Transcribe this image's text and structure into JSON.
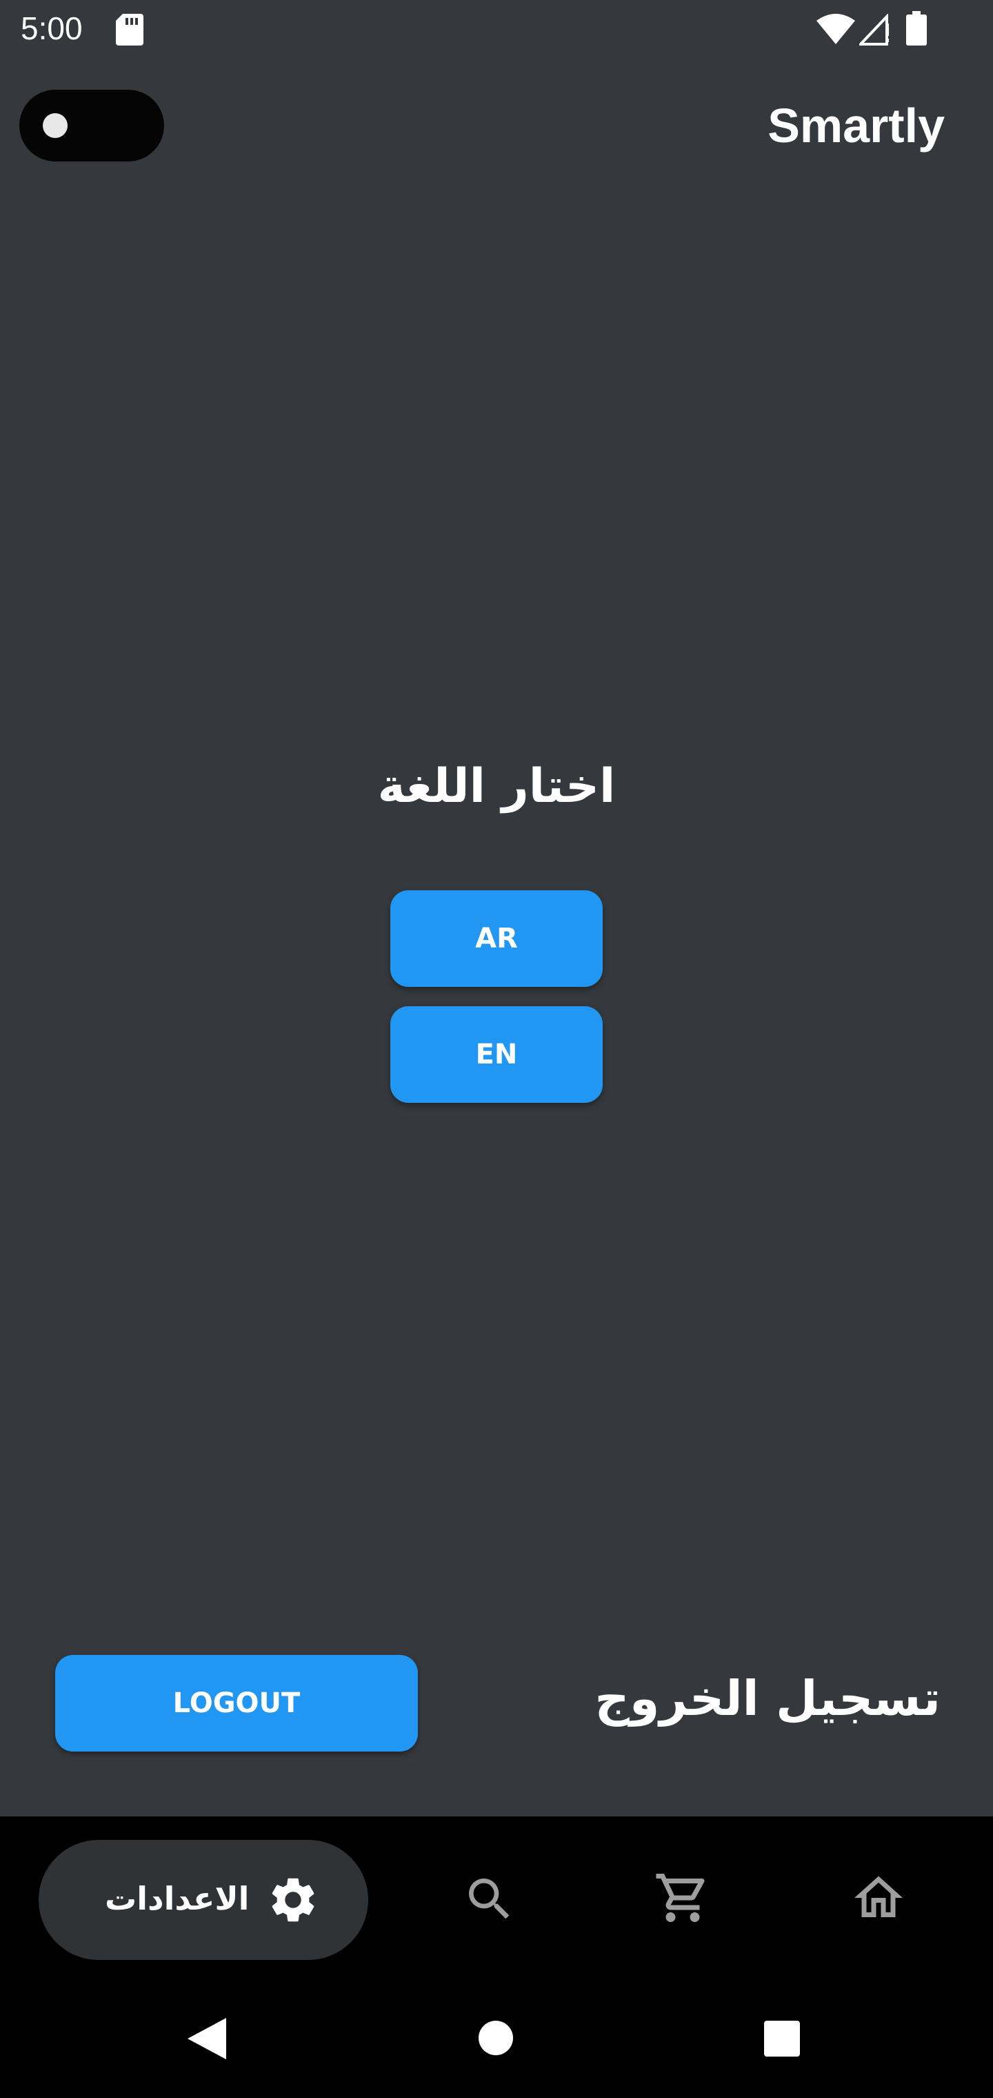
{
  "status_bar": {
    "time": "5:00"
  },
  "header": {
    "title": "Smartly"
  },
  "language": {
    "heading": "اختار اللغة",
    "ar_label": "AR",
    "en_label": "EN"
  },
  "logout": {
    "button_label": "LOGOUT",
    "label": "تسجيل الخروج"
  },
  "bottom_nav": {
    "settings_label": "الاعدادات",
    "icons": [
      "gear-icon",
      "search-icon",
      "cart-icon",
      "home-icon"
    ]
  },
  "colors": {
    "background": "#35383c",
    "accent": "#2196f3",
    "nav_background": "#000000"
  }
}
